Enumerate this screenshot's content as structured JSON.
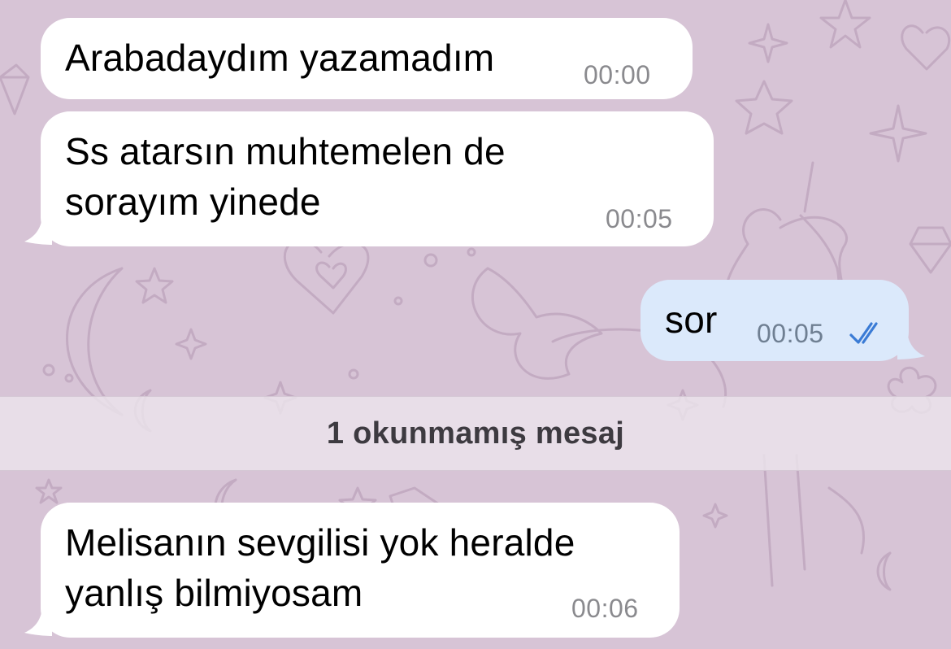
{
  "theme": {
    "background": "#d7c4d6",
    "incoming_bubble": "#ffffff",
    "outgoing_bubble": "#dbe9fb",
    "read_check_color": "#3a7bd5",
    "pattern": "doodle-pattern-unicorn-stars-hearts-moon"
  },
  "messages": [
    {
      "direction": "incoming",
      "text": "Arabadaydım yazamadım",
      "time": "00:00"
    },
    {
      "direction": "incoming",
      "text": "Ss atarsın muhtemelen de\nsorayım yinede",
      "time": "00:05"
    },
    {
      "direction": "outgoing",
      "text": "sor",
      "time": "00:05",
      "status": "read",
      "status_icon": "double-check-icon"
    }
  ],
  "unread_divider": {
    "label": "1 okunmamış mesaj"
  },
  "unread_messages": [
    {
      "direction": "incoming",
      "text": "Melisanın sevgilisi yok heralde\nyanlış bilmiyosam",
      "time": "00:06"
    }
  ]
}
